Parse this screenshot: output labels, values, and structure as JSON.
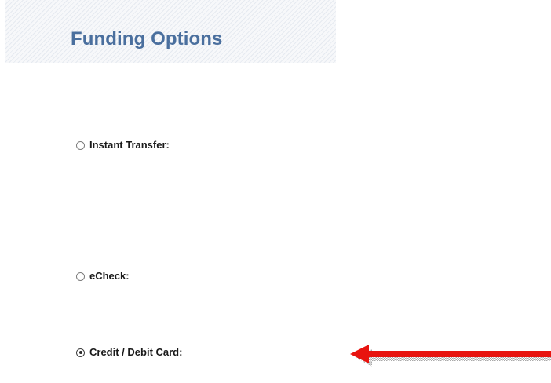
{
  "section": {
    "title": "Funding Options"
  },
  "funding_options": [
    {
      "label": "Instant Transfer:",
      "selected": false
    },
    {
      "label": "eCheck:",
      "selected": false
    },
    {
      "label": "Credit / Debit Card:",
      "selected": true
    }
  ],
  "annotation": {
    "arrow_color": "#e8140f",
    "arrow_shadow_color": "#a9a9a9",
    "arrow_direction": "left"
  }
}
